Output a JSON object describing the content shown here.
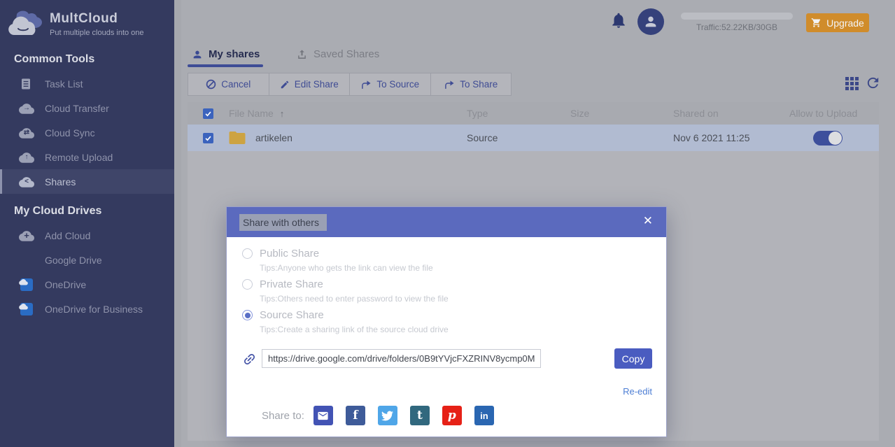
{
  "colors": {
    "sidebar-bg": "#343a5f",
    "sidebar-active-bg": "#3f4569",
    "sidebar-text": "#8f93ab",
    "accent-indigo": "#3e4c96",
    "modal-header": "#5b6abe",
    "copy-btn": "#4a5cc0",
    "upgrade-orange": "#d08c2b",
    "toggle-on": "#3d4f9c",
    "folder": "#cda342",
    "row-selected": "#b1bbd1",
    "checkbox-blue": "#3b63bd",
    "reedit-link": "#4d7ed4",
    "email": "#4253b4",
    "facebook": "#3e5b99",
    "twitter": "#4fa6e8",
    "tumblr": "#31687e",
    "pinterest": "#e62117",
    "linkedin": "#2a66b1"
  },
  "sidebar": {
    "logo": {
      "title": "MultCloud",
      "tagline": "Put multiple clouds into one"
    },
    "sections": [
      {
        "header": "Common Tools",
        "items": [
          {
            "label": "Task List",
            "icon": "task-list"
          },
          {
            "label": "Cloud Transfer",
            "icon": "cloud-transfer"
          },
          {
            "label": "Cloud Sync",
            "icon": "cloud-sync"
          },
          {
            "label": "Remote Upload",
            "icon": "remote-upload"
          },
          {
            "label": "Shares",
            "icon": "shares",
            "active": true
          }
        ]
      },
      {
        "header": "My Cloud Drives",
        "items": [
          {
            "label": "Add Cloud",
            "icon": "add-cloud"
          },
          {
            "label": "Google Drive",
            "icon": "google-drive"
          },
          {
            "label": "OneDrive",
            "icon": "onedrive"
          },
          {
            "label": "OneDrive for Business",
            "icon": "onedrive-business"
          }
        ]
      }
    ]
  },
  "topbar": {
    "traffic": "Traffic:52.22KB/30GB",
    "upgrade": "Upgrade"
  },
  "tabs": [
    {
      "label": "My shares",
      "active": true
    },
    {
      "label": "Saved Shares",
      "active": false
    }
  ],
  "toolbar": {
    "buttons": [
      {
        "label": "Cancel",
        "icon": "cancel"
      },
      {
        "label": "Edit Share",
        "icon": "edit"
      },
      {
        "label": "To Source",
        "icon": "branch-arrow"
      },
      {
        "label": "To Share",
        "icon": "branch-arrow"
      }
    ]
  },
  "table": {
    "columns": [
      "File Name",
      "Type",
      "Size",
      "Shared on",
      "Allow to Upload"
    ],
    "sort_indicator": "↑",
    "rows": [
      {
        "name": "artikelen",
        "type": "Source",
        "size": "",
        "shared_on": "Nov 6 2021 11:25",
        "allow_to_upload": true
      }
    ]
  },
  "modal": {
    "title": "Share with others",
    "options": [
      {
        "label": "Public Share",
        "tip": "Tips:Anyone who gets the link can view the file",
        "selected": false
      },
      {
        "label": "Private Share",
        "tip": "Tips:Others need to enter password to view the file",
        "selected": false
      },
      {
        "label": "Source Share",
        "tip": "Tips:Create a sharing link of the source cloud drive",
        "selected": true
      }
    ],
    "link_value": "https://drive.google.com/drive/folders/0B9tYVjcFXZRINV8ycmp0M",
    "copy_label": "Copy",
    "reedit_label": "Re-edit",
    "share_to_label": "Share to:",
    "share_targets": [
      "email",
      "facebook",
      "twitter",
      "tumblr",
      "pinterest",
      "linkedin"
    ]
  }
}
